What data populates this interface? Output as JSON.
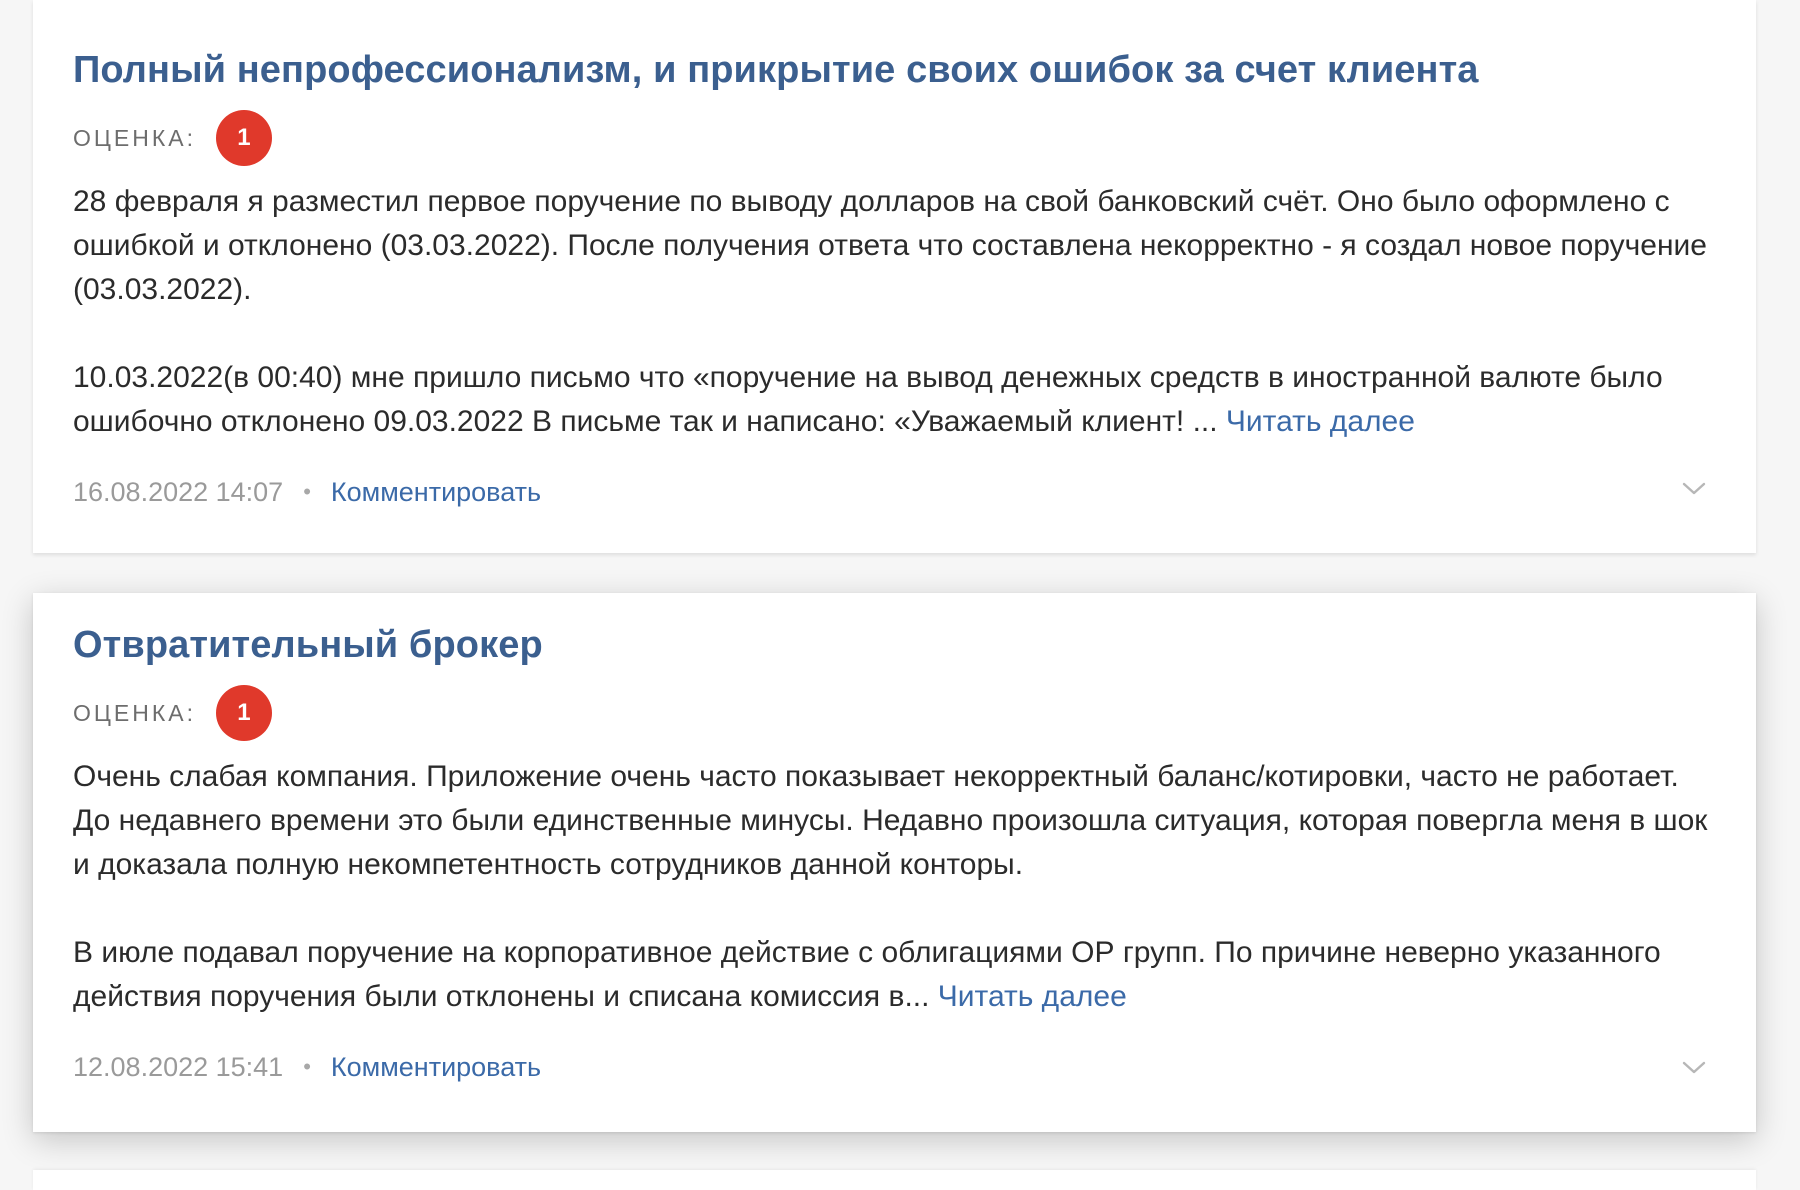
{
  "reviews": [
    {
      "title": "Полный непрофессионализм, и прикрытие своих ошибок за счет клиента",
      "rating_label": "Оценка:",
      "rating": "1",
      "paragraphs": [
        "28 февраля я разместил первое поручение по выводу долларов на свой банковский счёт. Оно было оформлено с ошибкой и отклонено (03.03.2022). После получения ответа что составлена некорректно - я создал новое поручение (03.03.2022).",
        "10.03.2022(в 00:40) мне пришло письмо что «поручение на вывод денежных средств в иностранной валюте было ошибочно отклонено 09.03.2022 В письме так и написано: «Уважаемый клиент! ... "
      ],
      "read_more": "Читать далее",
      "date": "16.08.2022 14:07",
      "comment_label": "Комментировать"
    },
    {
      "title": "Отвратительный брокер",
      "rating_label": "Оценка:",
      "rating": "1",
      "paragraphs": [
        "Очень слабая компания. Приложение очень часто показывает некорректный баланс/котировки, часто не работает. До недавнего времени это были единственные минусы. Недавно произошла ситуация, которая повергла меня в шок и доказала полную некомпетентность сотрудников данной конторы.",
        "В июле подавал поручение на корпоративное действие с облигациями ОР групп. По причине неверно указанного действия поручения были отклонены и списана комиссия в... "
      ],
      "read_more": "Читать далее",
      "date": "12.08.2022 15:41",
      "comment_label": "Комментировать"
    }
  ],
  "colors": {
    "title": "#3b5f8f",
    "link": "#3b6aa8",
    "badge": "#e0392b",
    "muted": "#9a9a9a"
  },
  "icons": {
    "expand": "chevron-down-icon"
  }
}
